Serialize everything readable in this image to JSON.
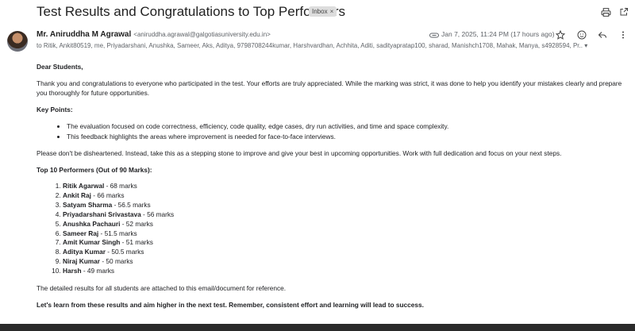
{
  "subject": "Test Results and Congratulations to Top Performers",
  "label_chip": "Inbox",
  "icons": {
    "print": "printer-icon",
    "open_new": "open-in-new-window-icon",
    "attachment": "attachment-icon",
    "star": "star-icon",
    "emoji": "emoji-icon",
    "reply": "reply-icon",
    "more": "more-vert-icon"
  },
  "sender": {
    "name": "Mr. Aniruddha M Agrawal",
    "email": "<aniruddha.agrawal@galgotiasuniversity.edu.in>",
    "recipients": "to Ritik, Ankit80519, me, Priyadarshani, Anushka, Sameer, Aks, Aditya, 9798708244kumar, Harshvardhan, Achhita, Aditi, sadityapratap100, sharad, Manishch1708, Mahak, Manya, s4928594, Pr.. ▾",
    "date": "Jan 7, 2025, 11:24 PM (17 hours ago)"
  },
  "body": {
    "greeting": "Dear Students,",
    "intro": "Thank you and congratulations to everyone who participated in the test. Your efforts are truly appreciated. While the marking was strict, it was done to help you identify your mistakes clearly and prepare you thoroughly for future opportunities.",
    "key_points_heading": "Key Points:",
    "key_points": [
      "The evaluation focused on code correctness, efficiency, code quality, edge cases, dry run activities, and time and space complexity.",
      "This feedback highlights the areas where improvement is needed for face-to-face interviews."
    ],
    "encouragement": "Please don't be disheartened. Instead, take this as a stepping stone to improve and give your best in upcoming opportunities. Work with full dedication and focus on your next steps.",
    "top_heading": "Top 10 Performers (Out of 90 Marks):",
    "performers": [
      {
        "name": "Ritik Agarwal",
        "marks": " - 68 marks"
      },
      {
        "name": "Ankit Raj",
        "marks": " - 66 marks"
      },
      {
        "name": "Satyam Sharma",
        "marks": " - 56.5 marks"
      },
      {
        "name": "Priyadarshani Srivastava",
        "marks": " - 56 marks"
      },
      {
        "name": "Anushka Pachauri",
        "marks": " - 52 marks"
      },
      {
        "name": "Sameer Raj",
        "marks": " - 51.5 marks"
      },
      {
        "name": "Amit Kumar Singh",
        "marks": " - 51 marks"
      },
      {
        "name": "Aditya Kumar",
        "marks": " - 50.5 marks"
      },
      {
        "name": "Niraj Kumar",
        "marks": " - 50 marks"
      },
      {
        "name": "Harsh",
        "marks": " - 49 marks"
      }
    ],
    "attached_note": "The detailed results for all students are attached to this email/document for reference.",
    "closing": "Let's learn from these results and aim higher in the next test. Remember, consistent effort and learning will lead to success."
  }
}
